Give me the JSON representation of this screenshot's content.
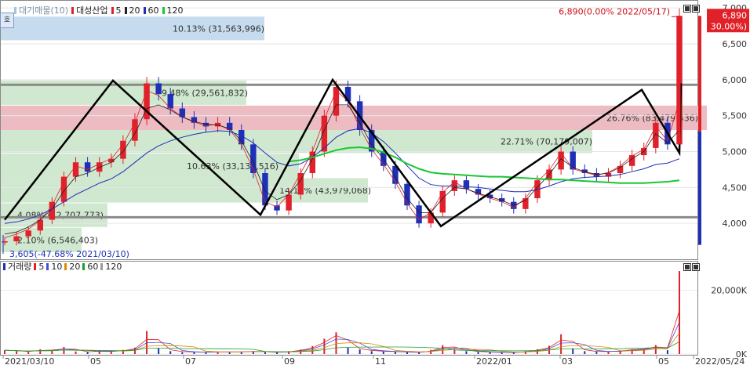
{
  "price_legend": {
    "items": [
      {
        "label": "대기매물(10)",
        "color": "#aac4dd"
      },
      {
        "label": "대성산업",
        "color": "#e0202a"
      },
      {
        "label": "5",
        "color": "#e0202a"
      },
      {
        "label": "20",
        "color": "#222222"
      },
      {
        "label": "60",
        "color": "#1f2fb8"
      },
      {
        "label": "120",
        "color": "#19c832"
      }
    ]
  },
  "side_icon": "호",
  "volume_legend": {
    "items": [
      {
        "label": "거래량",
        "color": "#1f2fb8"
      },
      {
        "label": "5",
        "color": "#e0202a"
      },
      {
        "label": "10",
        "color": "#4050d8"
      },
      {
        "label": "20",
        "color": "#e08a00"
      },
      {
        "label": "60",
        "color": "#19a032"
      },
      {
        "label": "120",
        "color": "#9a9a9a"
      }
    ]
  },
  "chart_data": [
    {
      "type": "line",
      "panel": "price",
      "y_ticks": [
        4000,
        4500,
        5000,
        5500,
        6000,
        6500,
        7000
      ],
      "y_tick_labels": [
        "4,000",
        "4,500",
        "5,000",
        "5,500",
        "6,000",
        "6,500",
        "7,000"
      ],
      "ylim": [
        3500,
        7100
      ],
      "x_range": [
        "2021/03/10",
        "2022/05/24"
      ],
      "x_tick_labels": [
        "2021/03/10",
        "05",
        "07",
        "09",
        "11",
        "2022/01",
        "03",
        "05",
        "2022/05/24"
      ],
      "current_price_label": "6,890",
      "current_change_label": "( 30.00%)",
      "high_annotation": "6,890(0.00% 2022/05/17)",
      "low_annotation": "3,605(-47.68% 2021/03/10)",
      "resistance_level": 5930,
      "support_level": 4085,
      "supply_zones": [
        {
          "label": "10.13% (31,563,996)",
          "low": 6550,
          "high": 6880,
          "color": "#c6dcee"
        },
        {
          "label": "9.48% (29,561,832)",
          "low": 5650,
          "high": 5990,
          "color": "#cfe8cf"
        },
        {
          "label": "26.76% (83,479,436)",
          "low": 5300,
          "high": 5640,
          "color": "#edbcc3"
        },
        {
          "label": "22.71% (70,179,007)",
          "low": 4980,
          "high": 5300,
          "color": "#cfe8cf"
        },
        {
          "label": "10.63% (33,136,516)",
          "low": 4630,
          "high": 4970,
          "color": "#cfe8cf"
        },
        {
          "label": "14.11% (43,979,068)",
          "low": 4290,
          "high": 4630,
          "color": "#cfe8cf"
        },
        {
          "label": "4.08% (12,707,773)",
          "low": 3950,
          "high": 4280,
          "color": "#cfe8cf"
        },
        {
          "label": "2.10% (6,546,403)",
          "low": 3600,
          "high": 3940,
          "color": "#cfe8cf"
        }
      ],
      "series": [
        {
          "name": "대성산업",
          "values": [
            3750,
            3820,
            3900,
            4050,
            4300,
            4650,
            4850,
            4720,
            4850,
            4900,
            5150,
            5450,
            5950,
            5800,
            5600,
            5480,
            5400,
            5350,
            5400,
            5300,
            5100,
            4700,
            4250,
            4180,
            4400,
            4700,
            5000,
            5500,
            5900,
            5700,
            5300,
            5000,
            4800,
            4550,
            4250,
            4000,
            4150,
            4450,
            4600,
            4480,
            4400,
            4350,
            4300,
            4200,
            4350,
            4600,
            4750,
            5000,
            4750,
            4700,
            4650,
            4700,
            4800,
            4950,
            5050,
            5400,
            5100,
            6890
          ]
        },
        {
          "name": "5",
          "values": [
            3800,
            3850,
            3920,
            4040,
            4250,
            4580,
            4800,
            4750,
            4830,
            4900,
            5100,
            5400,
            5850,
            5780,
            5600,
            5480,
            5410,
            5360,
            5380,
            5300,
            5100,
            4750,
            4300,
            4230,
            4400,
            4700,
            5000,
            5450,
            5850,
            5700,
            5330,
            5030,
            4820,
            4580,
            4280,
            4050,
            4150,
            4430,
            4580,
            4480,
            4410,
            4350,
            4300,
            4220,
            4350,
            4580,
            4740,
            4980,
            4760,
            4710,
            4670,
            4710,
            4800,
            4940,
            5030,
            5350,
            5150,
            5700
          ]
        },
        {
          "name": "20",
          "values": [
            3850,
            3880,
            3950,
            4050,
            4200,
            4450,
            4650,
            4700,
            4780,
            4850,
            5000,
            5250,
            5600,
            5650,
            5580,
            5480,
            5420,
            5380,
            5370,
            5320,
            5150,
            4850,
            4450,
            4330,
            4400,
            4600,
            4900,
            5300,
            5650,
            5650,
            5400,
            5100,
            4900,
            4650,
            4350,
            4150,
            4150,
            4350,
            4500,
            4480,
            4420,
            4370,
            4320,
            4250,
            4320,
            4500,
            4680,
            4900,
            4780,
            4720,
            4680,
            4700,
            4780,
            4900,
            5000,
            5250,
            5120,
            5300
          ]
        },
        {
          "name": "60",
          "values": [
            4000,
            4020,
            4060,
            4120,
            4200,
            4300,
            4400,
            4480,
            4560,
            4620,
            4720,
            4850,
            4980,
            5080,
            5150,
            5200,
            5240,
            5270,
            5290,
            5280,
            5220,
            5120,
            4980,
            4850,
            4800,
            4830,
            4920,
            5050,
            5200,
            5290,
            5320,
            5260,
            5140,
            4980,
            4800,
            4630,
            4540,
            4520,
            4520,
            4510,
            4500,
            4480,
            4460,
            4440,
            4440,
            4470,
            4520,
            4580,
            4620,
            4640,
            4650,
            4660,
            4680,
            4720,
            4760,
            4820,
            4840,
            4900
          ]
        },
        {
          "name": "120",
          "values": [
            null,
            null,
            null,
            null,
            null,
            null,
            null,
            null,
            null,
            null,
            null,
            null,
            null,
            null,
            null,
            null,
            null,
            null,
            null,
            null,
            null,
            null,
            null,
            null,
            4860,
            4880,
            4920,
            4970,
            5020,
            5050,
            5060,
            5040,
            4990,
            4920,
            4830,
            4760,
            4710,
            4690,
            4680,
            4670,
            4660,
            4650,
            4650,
            4640,
            4630,
            4620,
            4610,
            4610,
            4600,
            4590,
            4580,
            4570,
            4560,
            4560,
            4560,
            4570,
            4580,
            4600
          ]
        }
      ]
    },
    {
      "type": "bar",
      "panel": "volume",
      "y_ticks": [
        0,
        20000
      ],
      "y_tick_labels": [
        "0K",
        "20,000K"
      ],
      "ylim": [
        0,
        27000
      ],
      "series": [
        {
          "name": "거래량",
          "values": [
            1200,
            900,
            700,
            1500,
            1000,
            2200,
            800,
            600,
            1100,
            700,
            1300,
            2000,
            7200,
            1800,
            900,
            600,
            700,
            500,
            800,
            600,
            700,
            900,
            600,
            500,
            900,
            1400,
            2500,
            4800,
            6800,
            2000,
            1400,
            900,
            800,
            700,
            600,
            500,
            1300,
            2800,
            1600,
            900,
            700,
            600,
            500,
            500,
            900,
            1500,
            2600,
            6200,
            1800,
            900,
            700,
            800,
            1100,
            1500,
            1600,
            2800,
            1200,
            26000
          ]
        }
      ]
    }
  ]
}
